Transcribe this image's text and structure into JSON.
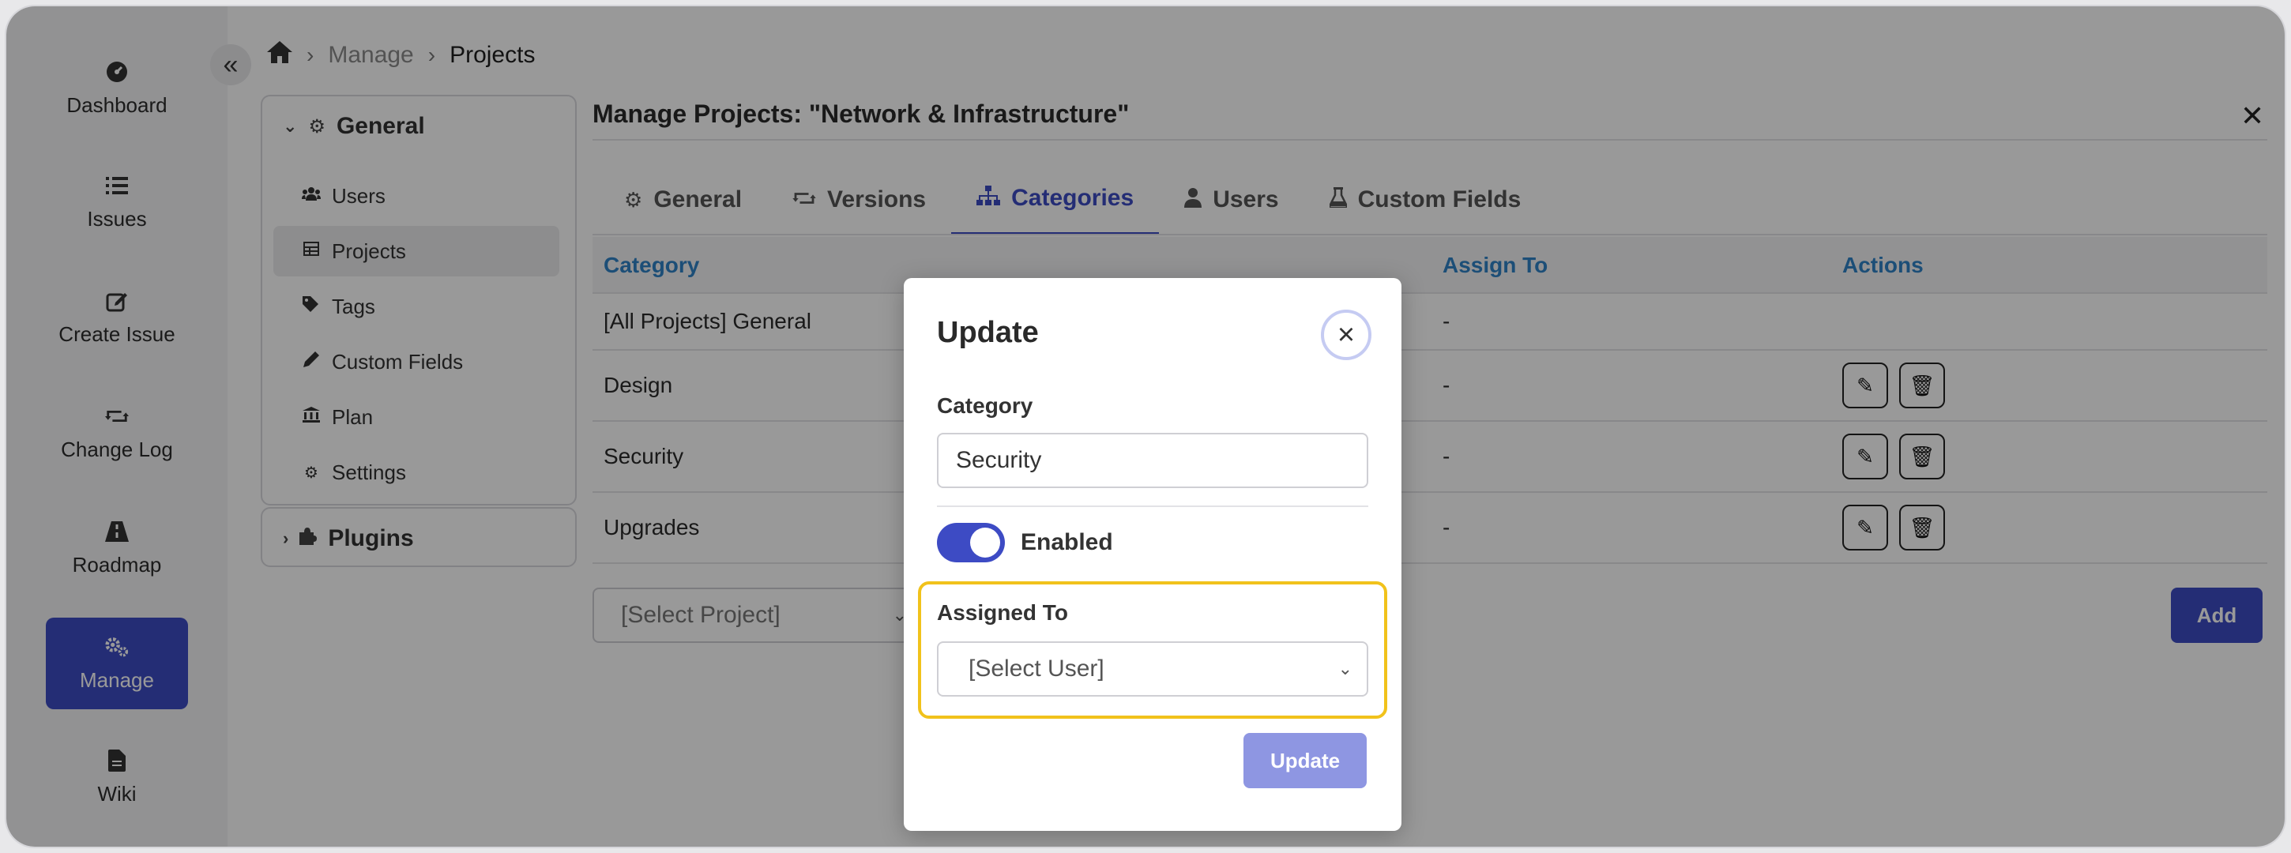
{
  "sidebar": {
    "items": [
      {
        "label": "Dashboard",
        "icon": "dashboard-icon"
      },
      {
        "label": "Issues",
        "icon": "list-icon"
      },
      {
        "label": "Create Issue",
        "icon": "edit-icon"
      },
      {
        "label": "Change Log",
        "icon": "retweet-icon"
      },
      {
        "label": "Roadmap",
        "icon": "road-icon"
      },
      {
        "label": "Manage",
        "icon": "cogs-icon",
        "active": true
      },
      {
        "label": "Wiki",
        "icon": "file-icon"
      }
    ]
  },
  "breadcrumb": {
    "items": [
      "Manage",
      "Projects"
    ]
  },
  "settings_nav": {
    "general": {
      "label": "General",
      "items": [
        "Users",
        "Projects",
        "Tags",
        "Custom Fields",
        "Plan",
        "Settings"
      ]
    },
    "plugins": {
      "label": "Plugins"
    }
  },
  "main": {
    "title": "Manage Projects: \"Network & Infrastructure\"",
    "tabs": [
      "General",
      "Versions",
      "Categories",
      "Users",
      "Custom Fields"
    ],
    "active_tab": "Categories"
  },
  "table": {
    "headers": [
      "Category",
      "Assign To",
      "Actions"
    ],
    "rows": [
      {
        "category": "[All Projects] General",
        "assign_to": "-"
      },
      {
        "category": "Design",
        "assign_to": "-"
      },
      {
        "category": "Security",
        "assign_to": "-"
      },
      {
        "category": "Upgrades",
        "assign_to": "-"
      }
    ]
  },
  "footer": {
    "project_select": "[Select Project]",
    "add_label": "Add"
  },
  "modal": {
    "title": "Update",
    "category_label": "Category",
    "category_value": "Security",
    "enabled_label": "Enabled",
    "enabled": true,
    "assigned_label": "Assigned To",
    "assigned_value": "[Select User]",
    "update_label": "Update"
  },
  "colors": {
    "accent": "#3d4bc4",
    "header_text": "#2f82c6",
    "highlight": "#f1c21b"
  }
}
